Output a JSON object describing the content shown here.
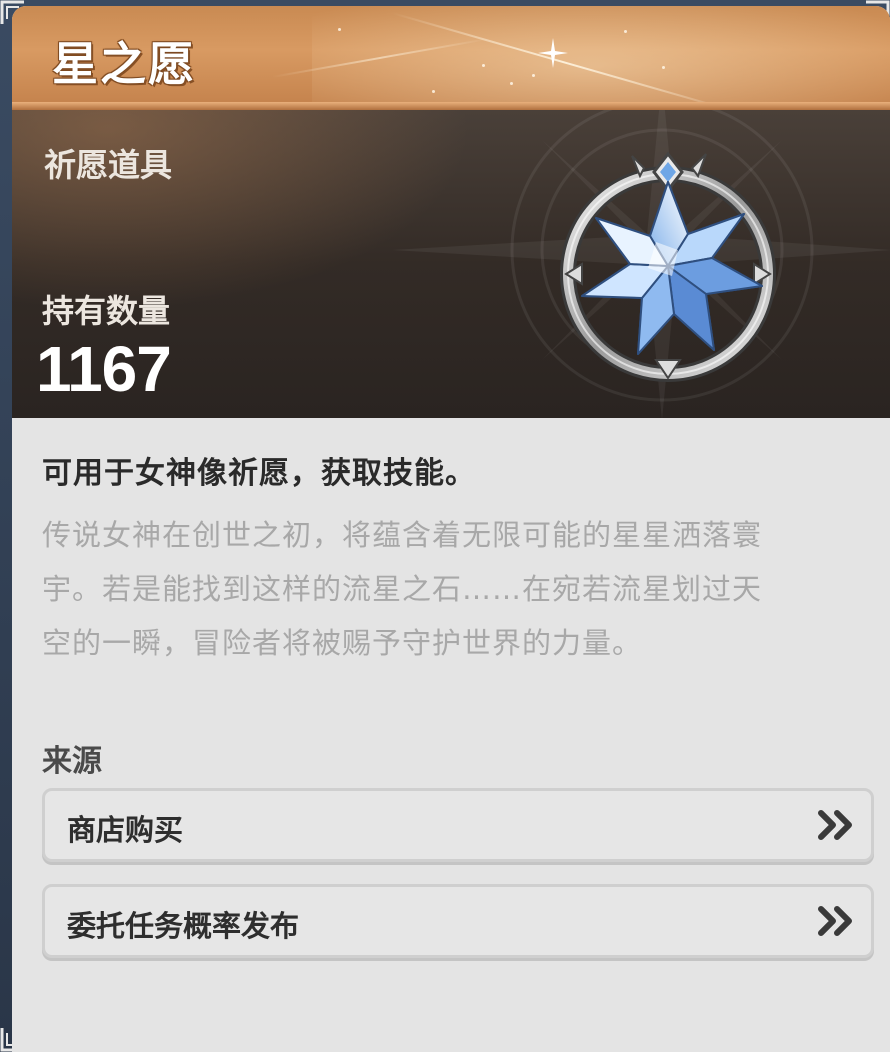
{
  "item": {
    "title": "星之愿",
    "category": "祈愿道具",
    "hold_label": "持有数量",
    "hold_value": "1167",
    "icon": "star-crystal-icon"
  },
  "description": {
    "main": "可用于女神像祈愿，获取技能。",
    "lore_lines": [
      "传说女神在创世之初，将蕴含着无限可能的星星洒落寰",
      "宇。若是能找到这样的流星之石……在宛若流星划过天",
      "空的一瞬，冒险者将被赐予守护世界的力量。"
    ]
  },
  "sources": {
    "heading": "来源",
    "items": [
      {
        "label": "商店购买",
        "icon": "double-chevron-right-icon"
      },
      {
        "label": "委托任务概率发布",
        "icon": "double-chevron-right-icon"
      }
    ]
  },
  "colors": {
    "header": "#d0925a",
    "info_bg": "#2f2824",
    "panel_bg": "#e4e4e4",
    "lore_text": "#a8a8a8"
  }
}
